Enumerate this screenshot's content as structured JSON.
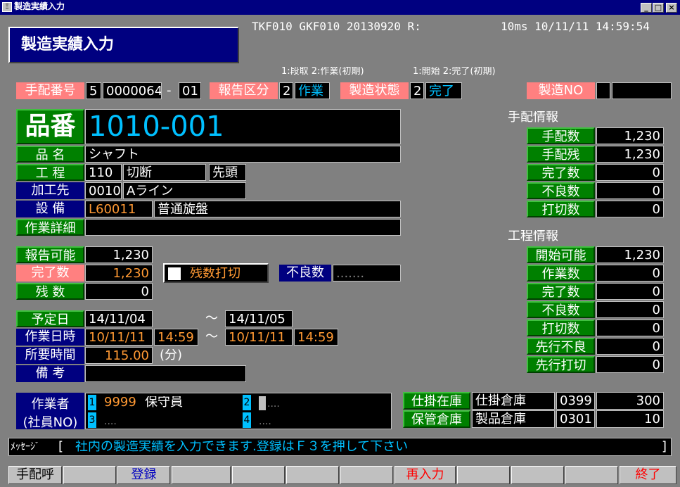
{
  "window": {
    "title": "製造実績入力",
    "min": "_",
    "max": "□",
    "close": "×"
  },
  "header": {
    "screen_title": "製造実績入力",
    "sysline_left": "TKF010 GKF010 20130920 R:",
    "sysline_right": "10ms 10/11/11 14:59:54",
    "hint_report": "1:段取 2:作業(初期)",
    "hint_status": "1:開始 2:完了(初期)"
  },
  "order": {
    "label": "手配番号",
    "type": "5",
    "number": "0000064",
    "dash": "-",
    "branch": "01",
    "report_label": "報告区分",
    "report_code": "2",
    "report_name": "作業",
    "status_label": "製造状態",
    "status_code": "2",
    "status_name": "完了",
    "mfg_no_label": "製造NO",
    "mfg_no": "",
    "mfg_no_2": ""
  },
  "item": {
    "part_label": "品番",
    "part_no": "1010-001",
    "name_label": "品 名",
    "name": "シャフト",
    "process_label": "工 程",
    "process_code": "110",
    "process_name": "切断",
    "process_seq": "先頭",
    "vendor_label": "加工先",
    "vendor_code": "0010",
    "vendor_name": "Aライン",
    "equip_label": "設 備",
    "equip_code": "L60011",
    "equip_name": "普通旋盤",
    "detail_label": "作業詳細",
    "detail": ""
  },
  "qty": {
    "reportable_label": "報告可能",
    "reportable": "1,230",
    "done_label": "完了数",
    "done": "1,230",
    "remain_label": "残 数",
    "remain": "0",
    "checkbox_label": "残数打切",
    "defect_label": "不良数",
    "defect": "......."
  },
  "schedule": {
    "planned_label": "予定日",
    "planned_start": "14/11/04",
    "tilde": "～",
    "planned_end": "14/11/05",
    "work_label": "作業日時",
    "work_start_date": "10/11/11",
    "work_start_time": "14:59",
    "work_end_date": "10/11/11",
    "work_end_time": "14:59",
    "duration_label": "所要時間",
    "duration": "115.00",
    "duration_unit": "(分)",
    "remarks_label": "備 考",
    "remarks": ""
  },
  "worker": {
    "label1": "作業者",
    "label2": "(社員NO)",
    "slot1": "1",
    "slot1_code": "9999",
    "slot1_name": "保守員",
    "slot2": "2",
    "slot3": "3",
    "slot4": "4",
    "empty": "...."
  },
  "arrange_info": {
    "title": "手配情報",
    "rows": [
      {
        "label": "手配数",
        "value": "1,230"
      },
      {
        "label": "手配残",
        "value": "1,230"
      },
      {
        "label": "完了数",
        "value": "0"
      },
      {
        "label": "不良数",
        "value": "0"
      },
      {
        "label": "打切数",
        "value": "0"
      }
    ]
  },
  "process_info": {
    "title": "工程情報",
    "rows": [
      {
        "label": "開始可能",
        "value": "1,230"
      },
      {
        "label": "作業数",
        "value": "0"
      },
      {
        "label": "完了数",
        "value": "0"
      },
      {
        "label": "不良数",
        "value": "0"
      },
      {
        "label": "打切数",
        "value": "0"
      },
      {
        "label": "先行不良",
        "value": "0"
      },
      {
        "label": "先行打切",
        "value": "0"
      }
    ]
  },
  "warehouse": {
    "wip_label": "仕掛在庫",
    "wip_name": "仕掛倉庫",
    "wip_code": "0399",
    "wip_qty": "300",
    "store_label": "保管倉庫",
    "store_name": "製品倉庫",
    "store_code": "0301",
    "store_qty": "10"
  },
  "message": {
    "label": "ﾒｯｾｰｼﾞ",
    "open": "[",
    "text": "社内の製造実績を入力できます.登録はＦ３を押して下さい",
    "close": "]"
  },
  "fkeys": [
    "手配呼",
    "",
    "登録",
    "",
    "",
    "",
    "",
    "再入力",
    "",
    "",
    "",
    "終了"
  ],
  "colors": {
    "background": "#808080",
    "navy": "#000080",
    "green": "#008000",
    "pink": "#ff8080",
    "cyan": "#00c0ff",
    "orange": "#ff9933",
    "fkey_red": "#ff0000",
    "fkey_blue": "#0000c0"
  }
}
